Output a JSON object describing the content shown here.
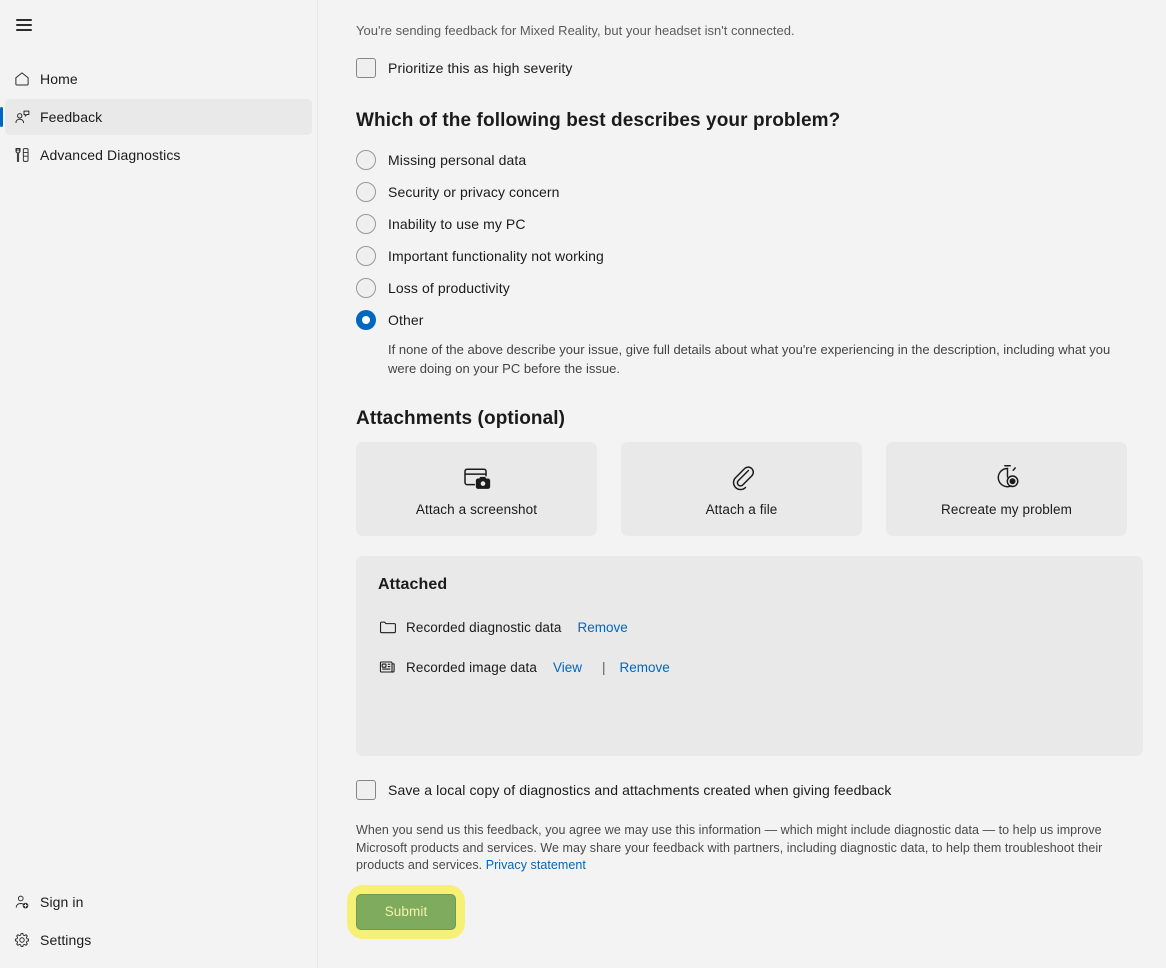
{
  "sidebar": {
    "menu_button": "menu-hamburger",
    "top_items": [
      {
        "label": "Home",
        "icon": "home-icon",
        "selected": false
      },
      {
        "label": "Feedback",
        "icon": "feedback-icon",
        "selected": true
      },
      {
        "label": "Advanced Diagnostics",
        "icon": "diagnostics-icon",
        "selected": false
      }
    ],
    "bottom_items": [
      {
        "label": "Sign in",
        "icon": "sign-in-icon"
      },
      {
        "label": "Settings",
        "icon": "gear-icon"
      }
    ]
  },
  "main": {
    "notice": "You're sending feedback for Mixed Reality, but your headset isn't connected.",
    "priority_checkbox": {
      "label": "Prioritize this as high severity",
      "checked": false
    },
    "problem_question": "Which of the following best describes your problem?",
    "problem_options": [
      {
        "label": "Missing personal data",
        "checked": false
      },
      {
        "label": "Security or privacy concern",
        "checked": false
      },
      {
        "label": "Inability to use my PC",
        "checked": false
      },
      {
        "label": "Important functionality not working",
        "checked": false
      },
      {
        "label": "Loss of productivity",
        "checked": false
      },
      {
        "label": "Other",
        "checked": true
      }
    ],
    "other_help": "If none of the above describe your issue, give full details about what you're experiencing in the description, including what you were doing on your PC before the issue.",
    "attachments_title": "Attachments (optional)",
    "attachment_cards": [
      {
        "label": "Attach a screenshot",
        "icon": "screenshot-camera-icon"
      },
      {
        "label": "Attach a file",
        "icon": "paperclip-icon"
      },
      {
        "label": "Recreate my problem",
        "icon": "stopwatch-record-icon"
      }
    ],
    "attached": {
      "title": "Attached",
      "items": [
        {
          "name": "Recorded diagnostic data",
          "icon": "folder-icon",
          "view_label": null,
          "remove_label": "Remove"
        },
        {
          "name": "Recorded image data",
          "icon": "image-data-icon",
          "view_label": "View",
          "separator": "|",
          "remove_label": "Remove"
        }
      ]
    },
    "save_copy_checkbox": {
      "label": "Save a local copy of diagnostics and attachments created when giving feedback",
      "checked": false
    },
    "legal_text": "When you send us this feedback, you agree we may use this information — which might include diagnostic data — to help us improve Microsoft products and services. We may share your feedback with partners, including diagnostic data, to help them troubleshoot their products and services. ",
    "privacy_link": "Privacy statement",
    "submit_label": "Submit"
  },
  "colors": {
    "accent": "#0067c0",
    "link": "#0067c0",
    "page_background": "#f3f3f3",
    "panel_background": "#e9e9e9",
    "submit_button": "#7fab5f",
    "submit_highlight": "#f7f077",
    "submit_text": "#f4f3a8"
  }
}
